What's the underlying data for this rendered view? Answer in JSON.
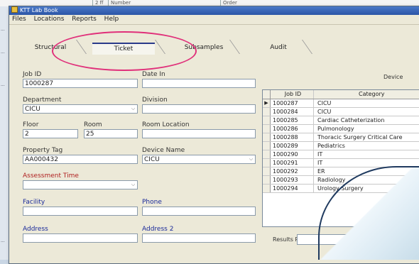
{
  "background": {
    "cells": [
      "2 ff",
      "Number",
      "Order"
    ]
  },
  "window": {
    "title": "KTT Lab Book",
    "menu": [
      "Files",
      "Locations",
      "Reports",
      "Help"
    ]
  },
  "tabs": [
    {
      "label": "Structural",
      "active": false
    },
    {
      "label": "Ticket",
      "active": true
    },
    {
      "label": "Subsamples",
      "active": false
    },
    {
      "label": "Audit",
      "active": false
    }
  ],
  "form": {
    "job_id_label": "Job ID",
    "job_id_value": "1000287",
    "date_in_label": "Date In",
    "date_in_value": "",
    "department_label": "Department",
    "department_value": "CICU",
    "division_label": "Division",
    "division_value": "",
    "floor_label": "Floor",
    "floor_value": "2",
    "room_label": "Room",
    "room_value": "25",
    "room_location_label": "Room Location",
    "room_location_value": "",
    "property_tag_label": "Property Tag",
    "property_tag_value": "AA000432",
    "device_name_label": "Device Name",
    "device_name_value": "CICU",
    "assessment_time_label": "Assessment Time",
    "assessment_time_value": "",
    "facility_label": "Facility",
    "facility_value": "",
    "phone_label": "Phone",
    "phone_value": "",
    "address_label": "Address",
    "address_value": "",
    "address2_label": "Address 2",
    "address2_value": ""
  },
  "grid": {
    "caption": "Device",
    "columns": [
      "Job ID",
      "Category"
    ],
    "rows": [
      {
        "id": "1000287",
        "name": "CICU",
        "current": true
      },
      {
        "id": "1000284",
        "name": "CICU",
        "current": false
      },
      {
        "id": "1000285",
        "name": "Cardiac Catheterization",
        "current": false
      },
      {
        "id": "1000286",
        "name": "Pulmonology",
        "current": false
      },
      {
        "id": "1000288",
        "name": "Thoracic Surgery Critical Care",
        "current": false
      },
      {
        "id": "1000289",
        "name": "Pediatrics",
        "current": false
      },
      {
        "id": "1000290",
        "name": "IT",
        "current": false
      },
      {
        "id": "1000291",
        "name": "IT",
        "current": false
      },
      {
        "id": "1000292",
        "name": "ER",
        "current": false
      },
      {
        "id": "1000293",
        "name": "Radiology",
        "current": false
      },
      {
        "id": "1000294",
        "name": "Urology Surgery",
        "current": false
      }
    ]
  },
  "footer": {
    "results_label": "Results Records"
  },
  "colors": {
    "highlight": "#e0307a",
    "titlebar": "#2b55a6"
  }
}
